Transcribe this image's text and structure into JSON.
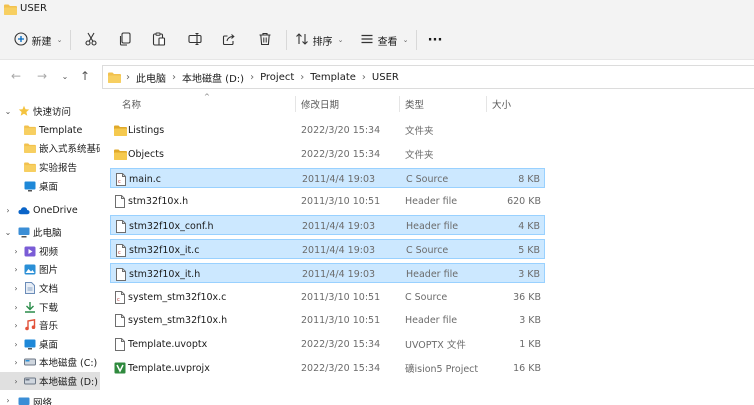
{
  "window": {
    "title": "USER"
  },
  "toolbar": {
    "new_label": "新建",
    "sort_label": "排序",
    "view_label": "查看",
    "more_label": "···",
    "icons": [
      "cut-icon",
      "copy-icon",
      "paste-icon",
      "rename-icon",
      "share-icon",
      "delete-icon"
    ]
  },
  "address": {
    "crumbs": [
      "此电脑",
      "本地磁盘 (D:)",
      "Project",
      "Template",
      "USER"
    ]
  },
  "sidebar": {
    "items": [
      {
        "label": "快速访问",
        "icon": "star-icon"
      },
      {
        "label": "Template",
        "icon": "folder-icon"
      },
      {
        "label": "嵌入式系统基础",
        "icon": "folder-icon"
      },
      {
        "label": "实验报告",
        "icon": "folder-icon"
      },
      {
        "label": "桌面",
        "icon": "desktop-icon"
      },
      {
        "label": "OneDrive",
        "icon": "cloud-icon"
      },
      {
        "label": "此电脑",
        "icon": "computer-icon"
      },
      {
        "label": "视频",
        "icon": "video-icon"
      },
      {
        "label": "图片",
        "icon": "picture-icon"
      },
      {
        "label": "文档",
        "icon": "document-icon"
      },
      {
        "label": "下载",
        "icon": "download-icon"
      },
      {
        "label": "音乐",
        "icon": "music-icon"
      },
      {
        "label": "桌面",
        "icon": "desktop-icon"
      },
      {
        "label": "本地磁盘 (C:)",
        "icon": "drive-icon"
      },
      {
        "label": "本地磁盘 (D:)",
        "icon": "drive-icon"
      },
      {
        "label": "网络",
        "icon": "network-icon"
      }
    ]
  },
  "columns": {
    "name": "名称",
    "date": "修改日期",
    "type": "类型",
    "size": "大小"
  },
  "files": [
    {
      "name": "Listings",
      "date": "2022/3/20 15:34",
      "type": "文件夹",
      "size": "",
      "icon": "folder-icon",
      "selected": false
    },
    {
      "name": "Objects",
      "date": "2022/3/20 15:34",
      "type": "文件夹",
      "size": "",
      "icon": "folder-icon",
      "selected": false
    },
    {
      "name": "main.c",
      "date": "2011/4/4 19:03",
      "type": "C Source",
      "size": "8 KB",
      "icon": "c-file-icon",
      "selected": true
    },
    {
      "name": "stm32f10x.h",
      "date": "2011/3/10 10:51",
      "type": "Header file",
      "size": "620 KB",
      "icon": "file-icon",
      "selected": false
    },
    {
      "name": "stm32f10x_conf.h",
      "date": "2011/4/4 19:03",
      "type": "Header file",
      "size": "4 KB",
      "icon": "file-icon",
      "selected": true
    },
    {
      "name": "stm32f10x_it.c",
      "date": "2011/4/4 19:03",
      "type": "C Source",
      "size": "5 KB",
      "icon": "c-file-icon",
      "selected": true
    },
    {
      "name": "stm32f10x_it.h",
      "date": "2011/4/4 19:03",
      "type": "Header file",
      "size": "3 KB",
      "icon": "file-icon",
      "selected": true
    },
    {
      "name": "system_stm32f10x.c",
      "date": "2011/3/10 10:51",
      "type": "C Source",
      "size": "36 KB",
      "icon": "c-file-icon",
      "selected": false
    },
    {
      "name": "system_stm32f10x.h",
      "date": "2011/3/10 10:51",
      "type": "Header file",
      "size": "3 KB",
      "icon": "file-icon",
      "selected": false
    },
    {
      "name": "Template.uvoptx",
      "date": "2022/3/20 15:34",
      "type": "UVOPTX 文件",
      "size": "1 KB",
      "icon": "file-icon",
      "selected": false
    },
    {
      "name": "Template.uvprojx",
      "date": "2022/3/20 15:34",
      "type": "礦ision5 Project",
      "size": "16 KB",
      "icon": "uvision-icon",
      "selected": false
    }
  ],
  "colors": {
    "selection": "#cce8ff",
    "selection_border": "#99d1ff",
    "folder": "#f2c14e",
    "accent": "#0067c0"
  }
}
